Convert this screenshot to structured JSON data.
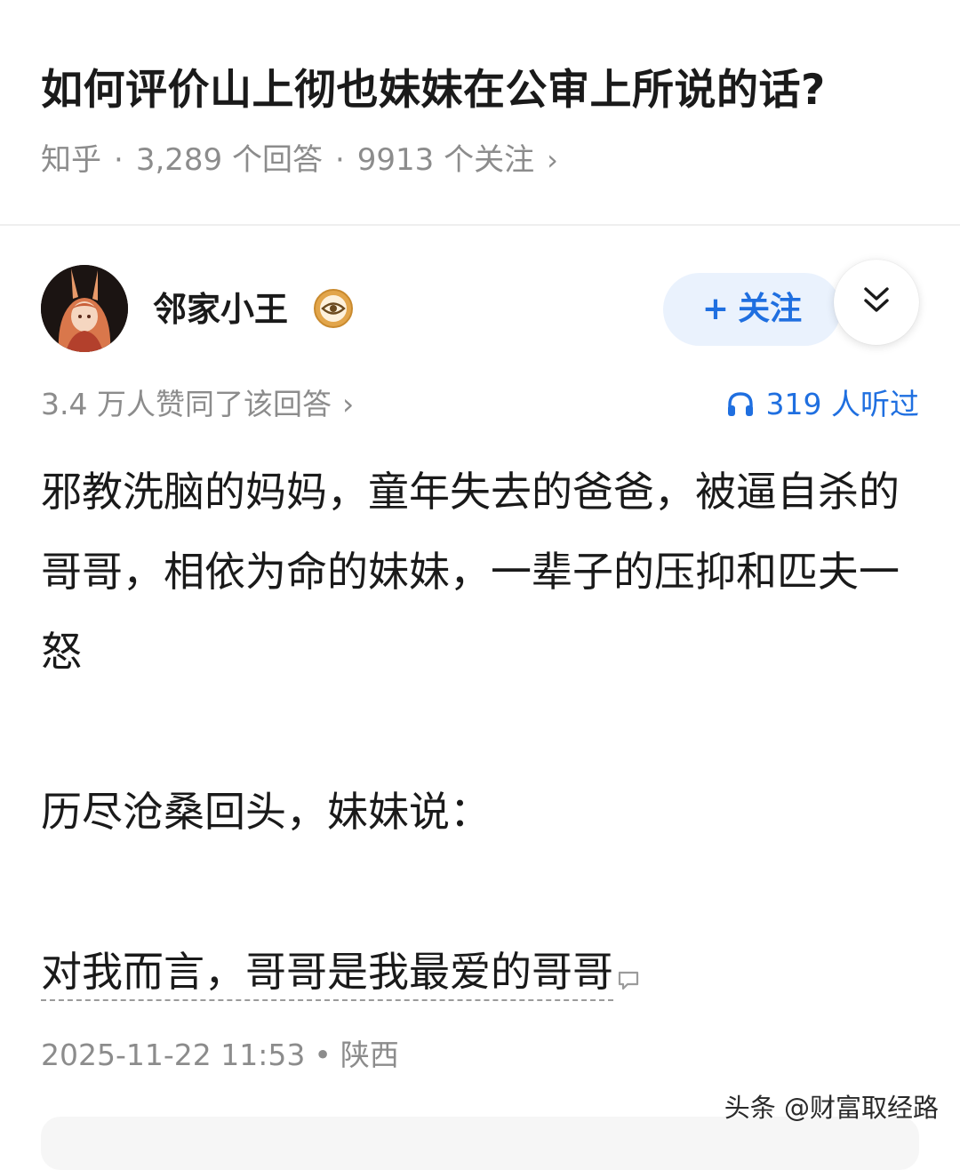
{
  "question": {
    "title": "如何评价山上彻也妹妹在公审上所说的话?",
    "source": "知乎",
    "answers": "3,289 个回答",
    "followers": "9913 个关注",
    "chevron_icon": "chevron-right-icon"
  },
  "author": {
    "name": "邻家小王",
    "badge_icon": "eye-badge-icon",
    "follow_label": "关注",
    "follow_icon": "plus-icon",
    "expand_icon": "double-chevron-down-icon"
  },
  "stats": {
    "upvotes": "3.4 万人赞同了该回答",
    "listen_icon": "headphones-icon",
    "listens": "319 人听过"
  },
  "answer": {
    "paragraph1": "邪教洗脑的妈妈，童年失去的爸爸，被逼自杀的哥哥，相依为命的妹妹，一辈子的压抑和匹夫一怒",
    "paragraph2": "历尽沧桑回头，妹妹说：",
    "paragraph3": "对我而言，哥哥是我最爱的哥哥",
    "comment_icon": "comment-bubble-icon"
  },
  "post": {
    "datetime": "2025-11-22 11:53",
    "location": "陕西"
  },
  "watermark": "头条 @财富取经路",
  "colors": {
    "accent": "#1f6fe0",
    "follow_bg": "#eaf2fd",
    "meta_gray": "#8c8c8c",
    "badge": "#e2a54a"
  }
}
